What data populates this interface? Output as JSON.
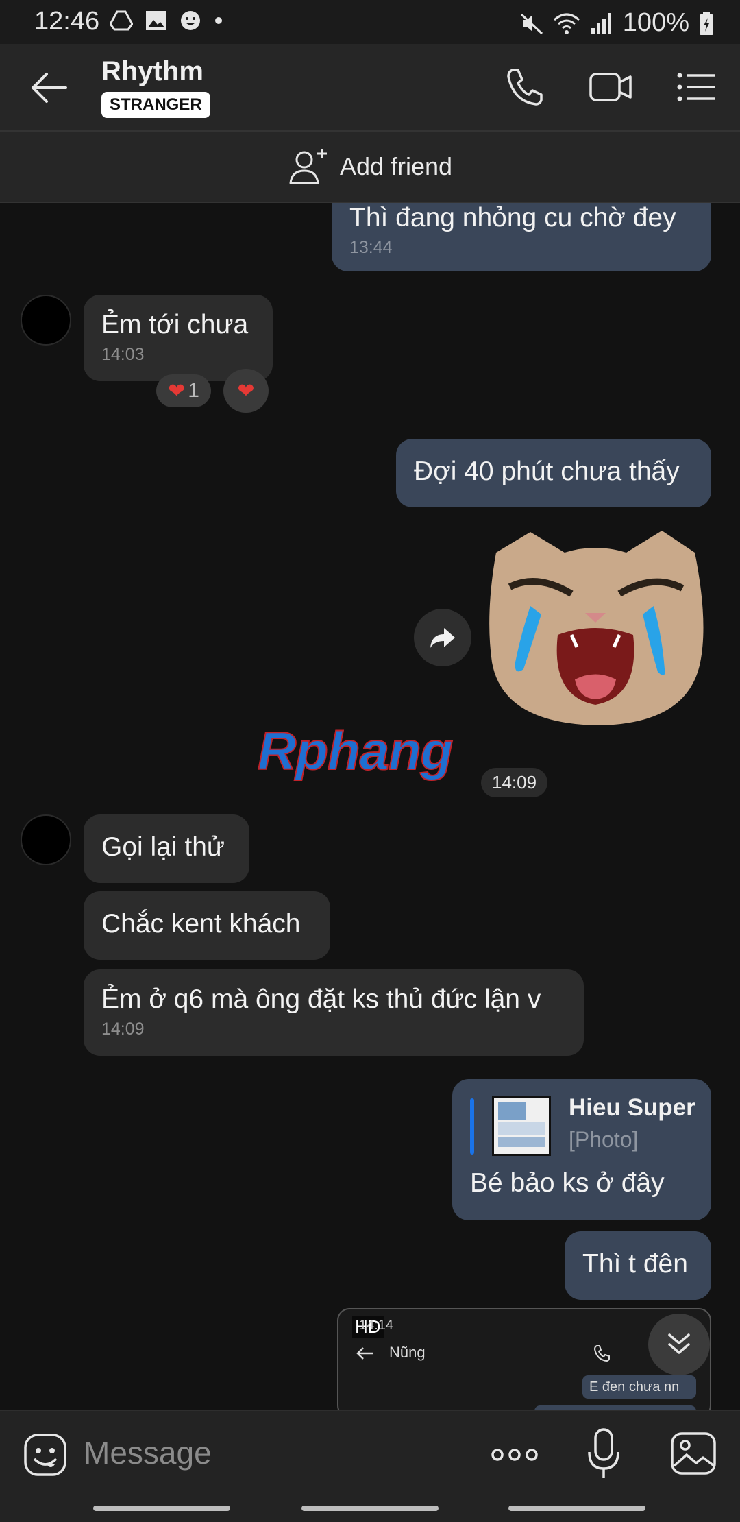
{
  "status_bar": {
    "time": "12:46",
    "battery": "100%",
    "left_icons": [
      "drive-icon",
      "image-icon",
      "emoji-icon",
      "dot-icon"
    ],
    "right_icons": [
      "mute-icon",
      "wifi-icon",
      "signal-icon",
      "battery-icon"
    ]
  },
  "header": {
    "name": "Rhythm",
    "badge": "STRANGER",
    "actions": [
      "phone-icon",
      "video-icon",
      "menu-icon"
    ]
  },
  "add_friend": {
    "label": "Add friend"
  },
  "messages": [
    {
      "id": "m1",
      "side": "out",
      "text": "Thì đang nhỏng cu chờ đey",
      "time": "13:44"
    },
    {
      "id": "m2",
      "side": "in",
      "text": "Ẻm tới chưa",
      "time": "14:03",
      "reactions": [
        {
          "emoji": "❤",
          "count": "1"
        },
        {
          "emoji": "❤",
          "count": ""
        }
      ]
    },
    {
      "id": "m3",
      "side": "out",
      "text": "Đợi 40 phút chưa thấy"
    },
    {
      "id": "m4",
      "side": "out",
      "type": "sticker",
      "description": "crying cat sticker",
      "time": "14:09"
    },
    {
      "id": "m5",
      "side": "in",
      "text": "Gọi lại thử"
    },
    {
      "id": "m6",
      "side": "in",
      "text": "Chắc kent khách"
    },
    {
      "id": "m7",
      "side": "in",
      "text": "Ẻm ở q6 mà ông đặt ks thủ đức lận v",
      "time": "14:09"
    },
    {
      "id": "m8",
      "side": "out",
      "type": "reply",
      "quoted_name": "Hieu Super",
      "quoted_type": "[Photo]",
      "text": "Bé bảo ks ở đây"
    },
    {
      "id": "m9",
      "side": "out",
      "text": "Thì t đên"
    },
    {
      "id": "m10",
      "side": "out",
      "type": "image",
      "badge": "HD",
      "preview": {
        "time": "14:14",
        "title": "Nũng",
        "snippet": "E đen chưa nn"
      }
    }
  ],
  "watermark": "Rphang",
  "input": {
    "placeholder": "Message"
  },
  "colors": {
    "outgoing": "#3a4659",
    "incoming": "#2c2c2c",
    "accent": "#1a73e8",
    "heart": "#e53935"
  }
}
